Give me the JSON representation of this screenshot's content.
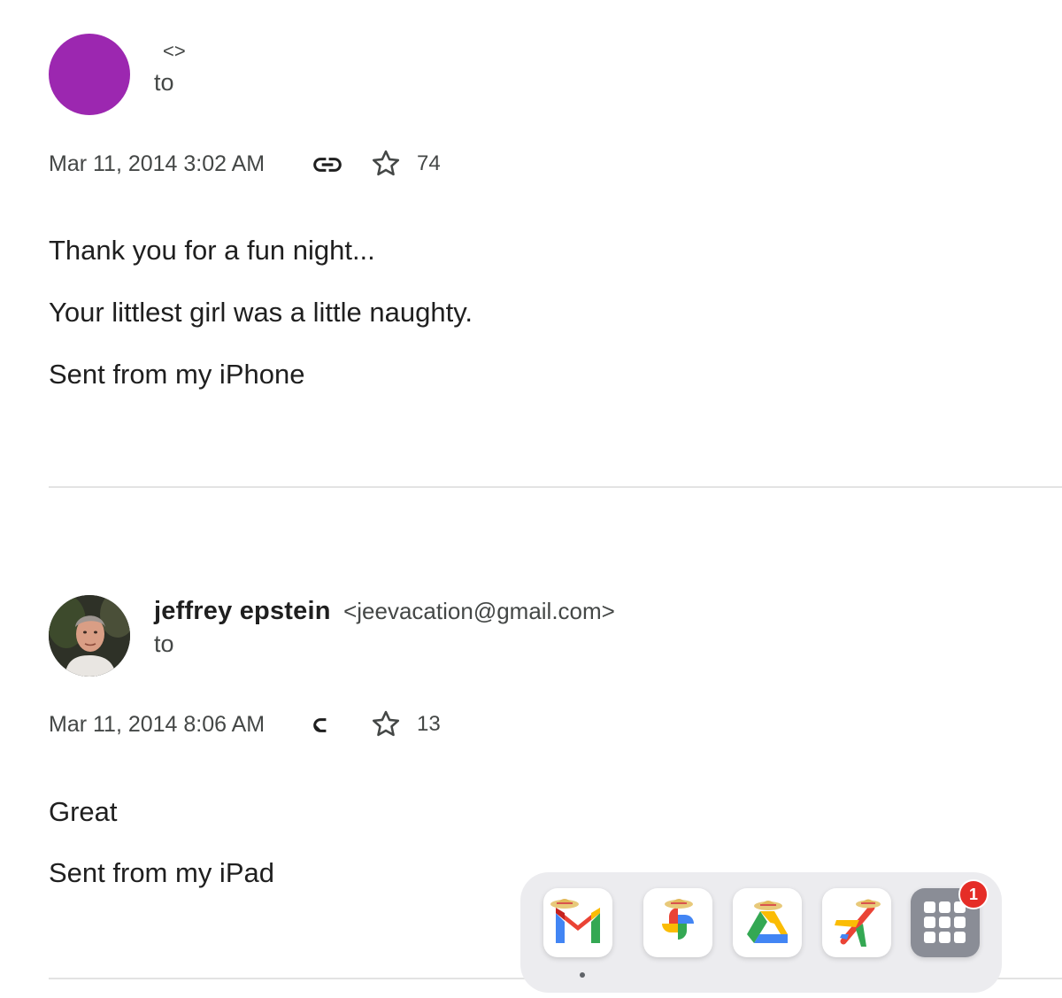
{
  "messages": [
    {
      "sender_name": "",
      "sender_email": "<>",
      "to_label": "to",
      "datetime": "Mar 11, 2014 3:02 AM",
      "link_icon": "link-icon",
      "star_icon": "star-outline-icon",
      "star_count": "74",
      "avatar_color": "#9c27b0",
      "body": [
        "Thank you for a fun night...",
        "Your littlest girl was a little naughty.",
        "Sent from my iPhone"
      ]
    },
    {
      "sender_name": "jeffrey epstein",
      "sender_email": "<jeevacation@gmail.com>",
      "to_label": "to",
      "datetime": "Mar 11, 2014 8:06 AM",
      "link_icon": "link-icon",
      "star_icon": "star-outline-icon",
      "star_count": "13",
      "avatar_color": "#2b2b27",
      "body": [
        "Great",
        "Sent from my iPad"
      ]
    }
  ],
  "dock": {
    "apps": [
      {
        "name": "Gmail",
        "icon": "gmail-icon",
        "active": true
      },
      {
        "name": "Photos",
        "icon": "photos-pinwheel-icon",
        "active": false
      },
      {
        "name": "Drive",
        "icon": "drive-icon",
        "active": false
      },
      {
        "name": "Travel",
        "icon": "airplane-icon",
        "active": false
      },
      {
        "name": "Apps",
        "icon": "app-grid-icon",
        "badge": "1"
      }
    ]
  },
  "colors": {
    "text_primary": "#1f1f1f",
    "text_secondary": "#444746",
    "divider": "#e3e3e3",
    "badge": "#e52d27"
  }
}
